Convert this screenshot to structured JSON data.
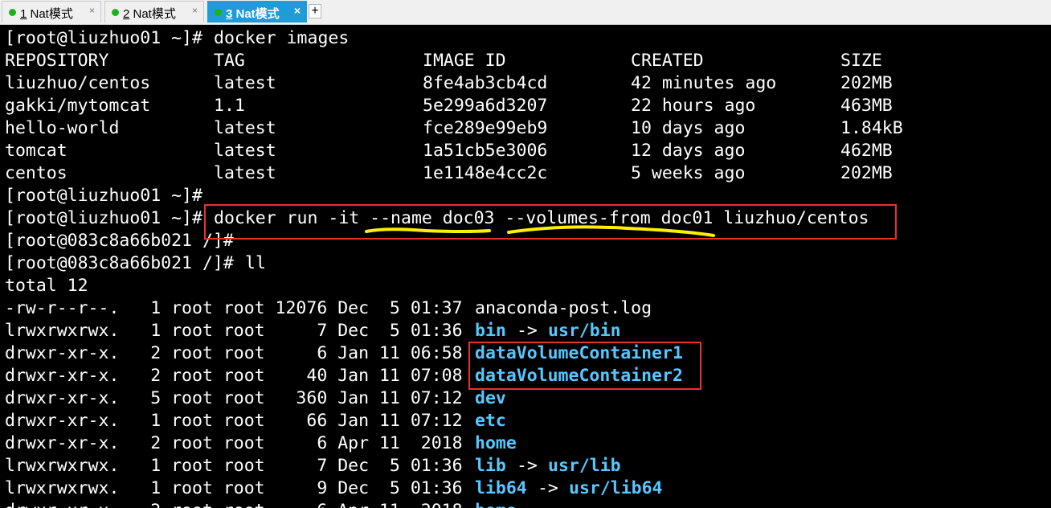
{
  "tabs": [
    {
      "num": "1",
      "title": " Nat模式"
    },
    {
      "num": "2",
      "title": " Nat模式"
    },
    {
      "num": "3",
      "title": " Nat模式"
    }
  ],
  "tab_close": "×",
  "new_tab": "+",
  "terminal": {
    "prompt1": "[root@liuzhuo01 ~]# ",
    "prompt2": "[root@083c8a66b021 /]#",
    "cmd_images": "docker images",
    "cmd_run": "docker run -it --name doc03 --volumes-from doc01 liuzhuo/centos",
    "cmd_ll": "ll",
    "images_header": [
      "REPOSITORY",
      "TAG",
      "IMAGE ID",
      "CREATED",
      "SIZE"
    ],
    "images": [
      [
        "liuzhuo/centos",
        "latest",
        "8fe4ab3cb4cd",
        "42 minutes ago",
        "202MB"
      ],
      [
        "gakki/mytomcat",
        "1.1",
        "5e299a6d3207",
        "22 hours ago",
        "463MB"
      ],
      [
        "hello-world",
        "latest",
        "fce289e99eb9",
        "10 days ago",
        "1.84kB"
      ],
      [
        "tomcat",
        "latest",
        "1a51cb5e3006",
        "12 days ago",
        "462MB"
      ],
      [
        "centos",
        "latest",
        "1e1148e4cc2c",
        "5 weeks ago",
        "202MB"
      ]
    ],
    "total": "total 12",
    "files": [
      {
        "meta": "-rw-r--r--.   1 root root 12076 Dec  5 01:37 ",
        "name": "anaconda-post.log",
        "type": "file",
        "arrow": "",
        "target": ""
      },
      {
        "meta": "lrwxrwxrwx.   1 root root     7 Dec  5 01:36 ",
        "name": "bin",
        "type": "link",
        "arrow": " -> ",
        "target": "usr/bin"
      },
      {
        "meta": "drwxr-xr-x.   2 root root     6 Jan 11 06:58 ",
        "name": "dataVolumeContainer1",
        "type": "dir",
        "arrow": "",
        "target": ""
      },
      {
        "meta": "drwxr-xr-x.   2 root root    40 Jan 11 07:08 ",
        "name": "dataVolumeContainer2",
        "type": "dir",
        "arrow": "",
        "target": ""
      },
      {
        "meta": "drwxr-xr-x.   5 root root   360 Jan 11 07:12 ",
        "name": "dev",
        "type": "dir",
        "arrow": "",
        "target": ""
      },
      {
        "meta": "drwxr-xr-x.   1 root root    66 Jan 11 07:12 ",
        "name": "etc",
        "type": "dir",
        "arrow": "",
        "target": ""
      },
      {
        "meta": "drwxr-xr-x.   2 root root     6 Apr 11  2018 ",
        "name": "home",
        "type": "dir",
        "arrow": "",
        "target": ""
      },
      {
        "meta": "lrwxrwxrwx.   1 root root     7 Dec  5 01:36 ",
        "name": "lib",
        "type": "link",
        "arrow": " -> ",
        "target": "usr/lib"
      },
      {
        "meta": "lrwxrwxrwx.   1 root root     9 Dec  5 01:36 ",
        "name": "lib64",
        "type": "link",
        "arrow": " -> ",
        "target": "usr/lib64"
      }
    ]
  },
  "colors": {
    "tab_active_bg": "#1f9cd8",
    "status_dot": "#1db11d",
    "directory_text": "#56c8ff",
    "annotation_red": "#e8322f",
    "annotation_yellow": "#fff000"
  }
}
